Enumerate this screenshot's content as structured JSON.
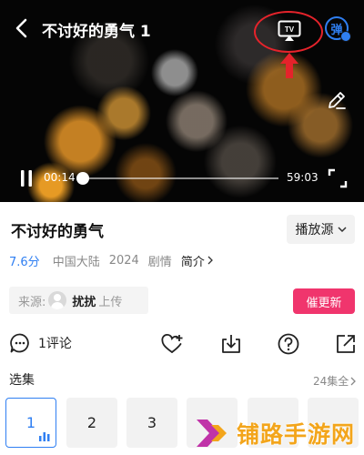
{
  "player": {
    "title": "不讨好的勇气 1",
    "tv_label": "TV",
    "danmu_label": "弹",
    "current_time": "00:14",
    "total_time": "59:03",
    "progress": 0.004
  },
  "info": {
    "show_title": "不讨好的勇气",
    "source_button": "播放源",
    "rating": "7.6分",
    "region": "中国大陆",
    "year": "2024",
    "genre": "剧情",
    "intro": "简介",
    "uploader_label": "来源:",
    "uploader_name": "扰扰",
    "uploader_action": "上传",
    "urge_button": "催更新"
  },
  "actions": {
    "comment": "1评论"
  },
  "episodes": {
    "label": "选集",
    "count": "24集全",
    "items": [
      "1",
      "2",
      "3",
      "",
      "",
      ""
    ],
    "active_index": 0
  },
  "watermark": {
    "text": "铺路手游网"
  },
  "colors": {
    "accent_blue": "#2f7ff2",
    "urge_pink": "#f0356d",
    "annotation_red": "#e5232b",
    "watermark_orange": "#f3a51b"
  }
}
